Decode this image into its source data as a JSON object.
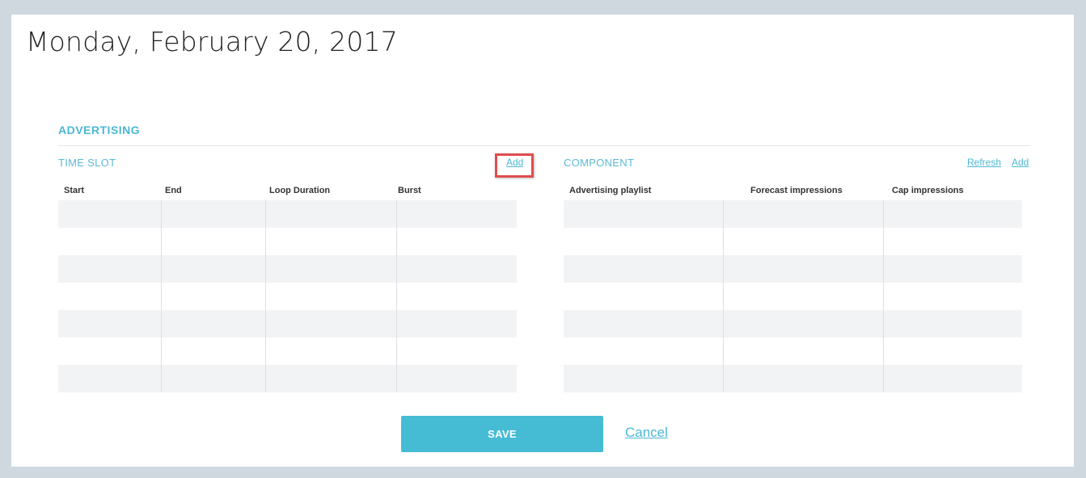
{
  "page": {
    "title": "Monday, February 20, 2017"
  },
  "advertising": {
    "heading": "ADVERTISING",
    "time_slot": {
      "label": "TIME SLOT",
      "add_label": "Add",
      "columns": [
        "Start",
        "End",
        "Loop Duration",
        "Burst"
      ],
      "row_count": 7
    },
    "component": {
      "label": "COMPONENT",
      "refresh_label": "Refresh",
      "add_label": "Add",
      "columns": [
        "Advertising playlist",
        "Forecast impressions",
        "Cap impressions"
      ],
      "row_count": 7
    }
  },
  "actions": {
    "save_label": "SAVE",
    "cancel_label": "Cancel"
  },
  "colors": {
    "accent": "#45bcd4",
    "highlight": "#e04d4d"
  }
}
